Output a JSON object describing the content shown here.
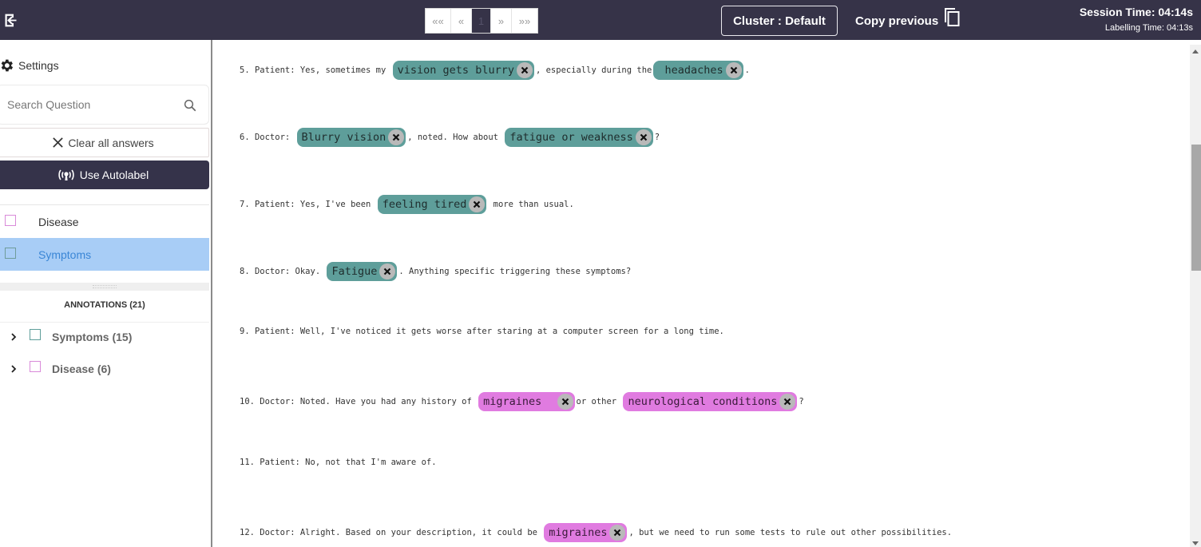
{
  "topbar": {
    "exit_icon": "exit-icon",
    "pagination": {
      "first": "««",
      "prev": "«",
      "current": "1",
      "next": "»",
      "last": "»»"
    },
    "cluster_label": "Cluster : Default",
    "copy_previous_label": "Copy previous",
    "copy_icon": "copy-icon",
    "session_time": "Session Time: 04:14s",
    "labelling_time": "Labelling Time: 04:13s"
  },
  "sidebar": {
    "settings_label": "Settings",
    "search": {
      "placeholder": "Search Question",
      "value": ""
    },
    "clear_all_label": "Clear all answers",
    "autolabel_label": "Use Autolabel",
    "labels": [
      {
        "name": "Disease",
        "color": "#e07be0",
        "selected": false
      },
      {
        "name": "Symptoms",
        "color": "#5e9e9a",
        "selected": true
      }
    ],
    "annotations_title": "ANNOTATIONS (21)",
    "annotation_groups": [
      {
        "label": "Symptoms (15)",
        "color": "#5e9e9a"
      },
      {
        "label": "Disease (6)",
        "color": "#e07be0"
      }
    ]
  },
  "colors": {
    "symptoms": "#5e9e9a",
    "disease": "#e07be0",
    "topbar": "#363348",
    "selected_label_bg": "#a8cdf6"
  },
  "transcript": [
    {
      "segments": [
        {
          "t": "5. Patient: Yes, sometimes my "
        },
        {
          "tag": "vision gets blurry",
          "label": "Symptoms"
        },
        {
          "t": ", especially during the"
        },
        {
          "tag": " headaches",
          "label": "Symptoms"
        },
        {
          "t": "."
        }
      ]
    },
    {
      "segments": [
        {
          "t": "6. Doctor: "
        },
        {
          "tag": "Blurry vision",
          "label": "Symptoms"
        },
        {
          "t": ", noted. How about "
        },
        {
          "tag": "fatigue or weakness",
          "label": "Symptoms"
        },
        {
          "t": "?"
        }
      ]
    },
    {
      "segments": [
        {
          "t": "7. Patient: Yes, I've been "
        },
        {
          "tag": "feeling tired",
          "label": "Symptoms"
        },
        {
          "t": " more than usual."
        }
      ]
    },
    {
      "segments": [
        {
          "t": "8. Doctor: Okay. "
        },
        {
          "tag": "Fatigue",
          "label": "Symptoms"
        },
        {
          "t": ". Anything specific triggering these symptoms?"
        }
      ]
    },
    {
      "segments": [
        {
          "t": "9. Patient: Well, I've noticed it gets worse after staring at a computer screen for a long time."
        }
      ]
    },
    {
      "segments": [
        {
          "t": "10. Doctor: Noted. Have you had any history of "
        },
        {
          "tag": "migraines  ",
          "label": "Disease"
        },
        {
          "t": "or other "
        },
        {
          "tag": "neurological conditions",
          "label": "Disease"
        },
        {
          "t": "?"
        }
      ]
    },
    {
      "segments": [
        {
          "t": "11. Patient: No, not that I'm aware of."
        }
      ]
    },
    {
      "segments": [
        {
          "t": "12. Doctor: Alright. Based on your description, it could be "
        },
        {
          "tag": "migraines",
          "label": "Disease"
        },
        {
          "t": ", but we need to run some tests to rule out other possibilities."
        }
      ]
    }
  ]
}
